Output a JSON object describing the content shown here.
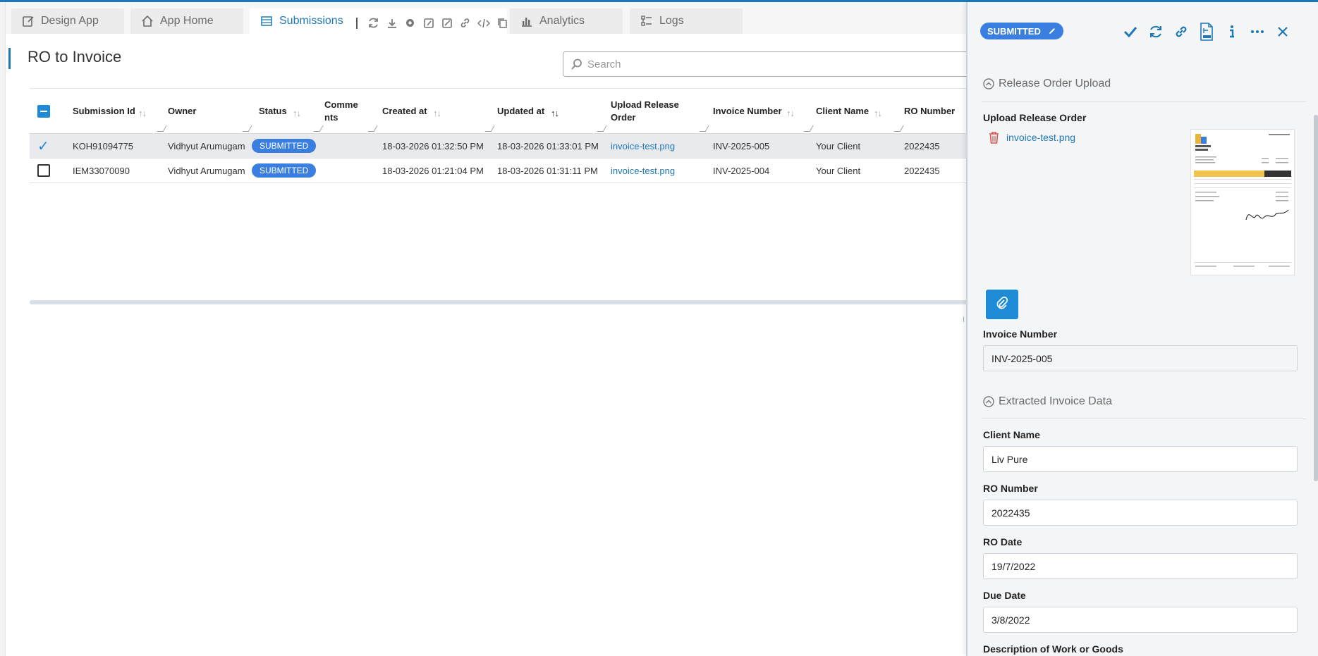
{
  "tabs": [
    {
      "label": "Design App",
      "icon": "edit-square-icon"
    },
    {
      "label": "App Home",
      "icon": "home-icon"
    },
    {
      "label": "Submissions",
      "icon": "table-icon",
      "active": true
    },
    {
      "label": "Analytics",
      "icon": "bar-chart-icon"
    },
    {
      "label": "Logs",
      "icon": "list-icon"
    }
  ],
  "toolbar_icons": [
    "refresh-icon",
    "download-icon",
    "settings-icon",
    "edit-doc-icon",
    "edit-check-icon",
    "link-icon",
    "code-icon",
    "copy-icon"
  ],
  "page": {
    "title": "RO to Invoice"
  },
  "search": {
    "placeholder": "Search",
    "value": ""
  },
  "table": {
    "columns": [
      "Submission Id",
      "Owner",
      "Status",
      "Comme nts",
      "Created at",
      "Updated at",
      "Upload Release Order",
      "Invoice Number",
      "Client Name",
      "RO Number"
    ],
    "rows": [
      {
        "selected": true,
        "id": "KOH91094775",
        "owner": "Vidhyut Arumugam",
        "status": "SUBMITTED",
        "comments": "",
        "created": "18-03-2026 01:32:50 PM",
        "updated": "18-03-2026 01:33:01 PM",
        "file": "invoice-test.png",
        "invoice": "INV-2025-005",
        "client": "Your Client",
        "ro": "2022435"
      },
      {
        "selected": false,
        "id": "IEM33070090",
        "owner": "Vidhyut Arumugam",
        "status": "SUBMITTED",
        "comments": "",
        "created": "18-03-2026 01:21:04 PM",
        "updated": "18-03-2026 01:31:11 PM",
        "file": "invoice-test.png",
        "invoice": "INV-2025-004",
        "client": "Your Client",
        "ro": "2022435"
      }
    ],
    "pager_fragment": "I"
  },
  "panel": {
    "status_badge": "SUBMITTED",
    "section_upload": "Release Order Upload",
    "upload_label": "Upload Release Order",
    "uploaded_file": "invoice-test.png",
    "invoice_number_label": "Invoice Number",
    "invoice_number_value": "INV-2025-005",
    "section_extracted": "Extracted Invoice Data",
    "client_name_label": "Client Name",
    "client_name_value": "Liv Pure",
    "ro_number_label": "RO Number",
    "ro_number_value": "2022435",
    "ro_date_label": "RO Date",
    "ro_date_value": "19/7/2022",
    "due_date_label": "Due Date",
    "due_date_value": "3/8/2022",
    "description_label": "Description of Work or Goods"
  },
  "colors": {
    "accent": "#1f78b4",
    "badge": "#3a7fe0",
    "delete": "#d9534f"
  }
}
